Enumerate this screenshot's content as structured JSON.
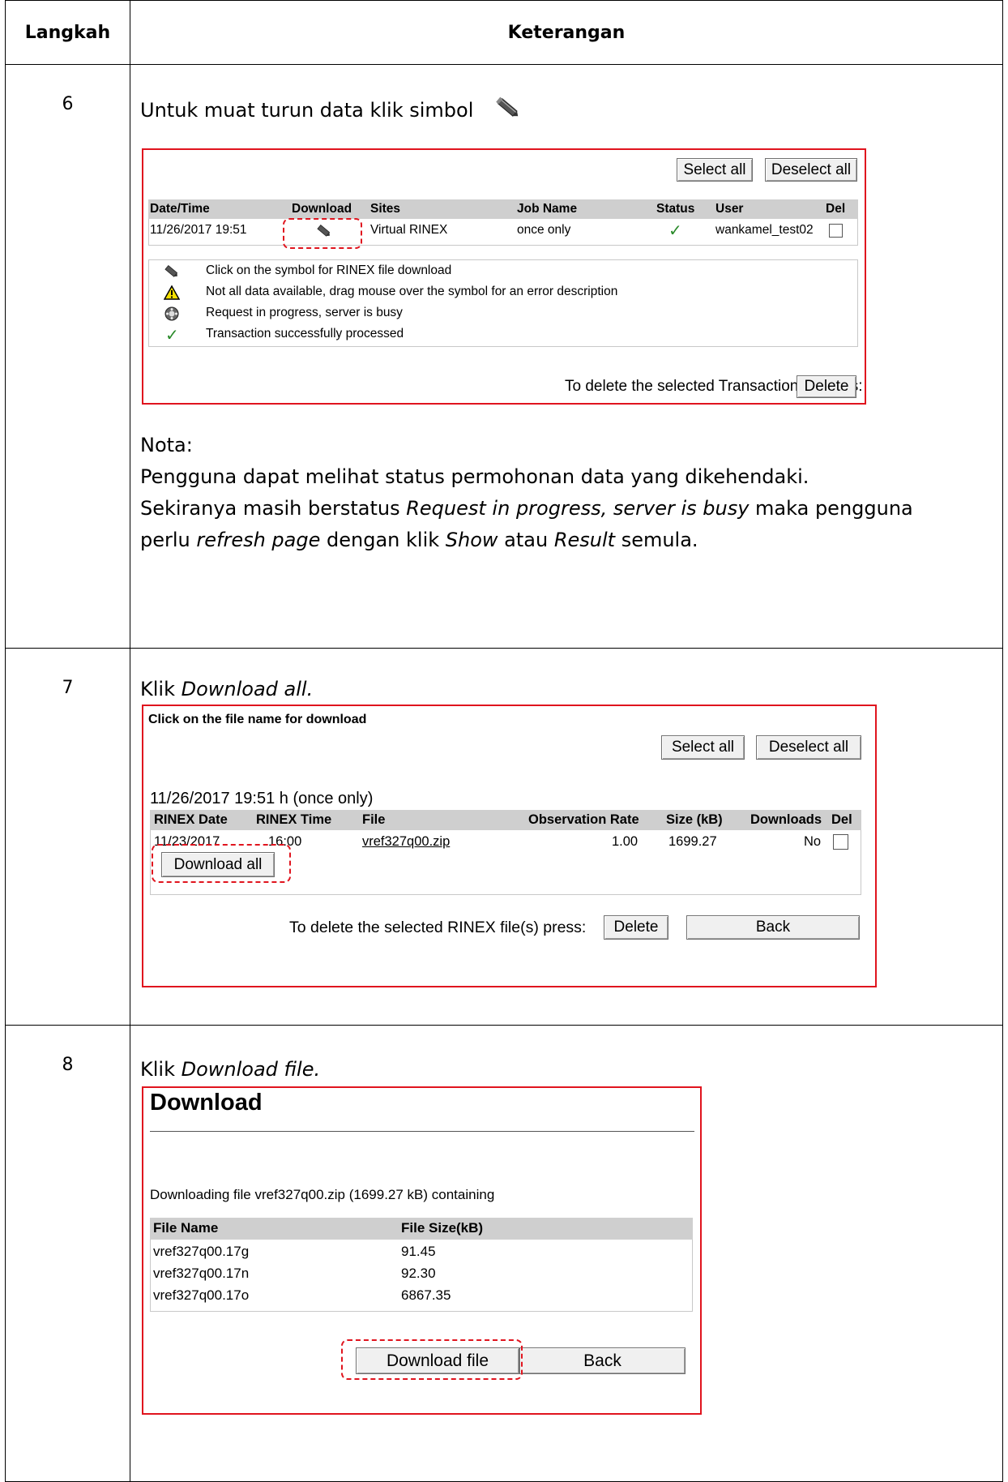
{
  "headers": {
    "step": "Langkah",
    "description": "Keterangan"
  },
  "step6": {
    "number": "6",
    "intro": "Untuk muat turun data klik simbol",
    "shot": {
      "select_all": "Select all",
      "deselect_all": "Deselect all",
      "columns": [
        "Date/Time",
        "Download",
        "Sites",
        "Job Name",
        "Status",
        "User",
        "Del"
      ],
      "row": {
        "datetime": "11/26/2017 19:51",
        "site": "Virtual RINEX",
        "job": "once only",
        "status": "✓",
        "user": "wankamel_test02"
      },
      "legend": [
        {
          "icon": "pencil-icon",
          "text": "Click on the symbol for RINEX file download"
        },
        {
          "icon": "warning-icon",
          "text": "Not all data available, drag mouse over the symbol for an error description"
        },
        {
          "icon": "busy-icon",
          "text": "Request in progress, server is busy"
        },
        {
          "icon": "checkmark-icon",
          "text": "Transaction successfully processed"
        }
      ],
      "delete_prompt": "To delete the selected Transaction(s) press:",
      "delete": "Delete"
    },
    "nota_title": "Nota:",
    "nota_line1": "Pengguna dapat melihat status permohonan data yang dikehendaki.",
    "nota_line2_a": "Sekiranya masih berstatus ",
    "nota_line2_b": "Request in progress, server is busy",
    "nota_line2_c": " maka pengguna",
    "nota_line3_a": "perlu ",
    "nota_line3_b": "refresh page",
    "nota_line3_c": " dengan klik ",
    "nota_line3_d": "Show",
    "nota_line3_e": " atau ",
    "nota_line3_f": "Result",
    "nota_line3_g": " semula."
  },
  "step7": {
    "number": "7",
    "intro_a": "Klik ",
    "intro_b": "Download all.",
    "shot": {
      "heading": "Click on the file name for download",
      "select_all": "Select all",
      "deselect_all": "Deselect all",
      "job_title": "11/26/2017 19:51 h (once only)",
      "columns": [
        "RINEX Date",
        "RINEX Time",
        "File",
        "Observation Rate",
        "Size (kB)",
        "Downloads",
        "Del"
      ],
      "row": {
        "date": "11/23/2017",
        "time": "16:00",
        "file": "vref327q00.zip",
        "rate": "1.00",
        "size": "1699.27",
        "downloads": "No"
      },
      "download_all": "Download all",
      "delete_prompt": "To delete the selected RINEX file(s) press:",
      "delete": "Delete",
      "back": "Back"
    }
  },
  "step8": {
    "number": "8",
    "intro_a": "Klik ",
    "intro_b": "Download file.",
    "shot": {
      "title": "Download",
      "message": "Downloading file vref327q00.zip (1699.27 kB) containing",
      "columns": [
        "File Name",
        "File Size(kB)"
      ],
      "rows": [
        {
          "name": "vref327q00.17g",
          "size": "91.45"
        },
        {
          "name": "vref327q00.17n",
          "size": "92.30"
        },
        {
          "name": "vref327q00.17o",
          "size": "6867.35"
        }
      ],
      "download_file": "Download file",
      "back": "Back"
    }
  }
}
